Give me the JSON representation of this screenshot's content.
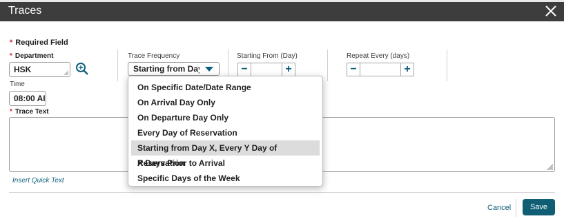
{
  "dialog": {
    "title": "Traces",
    "required_field": "Required Field"
  },
  "form": {
    "department": {
      "label": "Department",
      "value": "HSK"
    },
    "time": {
      "label": "Time",
      "value": "08:00 AI"
    },
    "trace_frequency": {
      "label": "Trace Frequency",
      "selected": "Starting from Day X"
    },
    "starting_from": {
      "label": "Starting From (Day)",
      "value": ""
    },
    "repeat_every": {
      "label": "Repeat Every (days)",
      "value": ""
    },
    "trace_text": {
      "label": "Trace Text",
      "value": ""
    },
    "insert_quick_text": "Insert Quick Text"
  },
  "dropdown": {
    "options": [
      "On Specific Date/Date Range",
      "On Arrival Day Only",
      "On Departure Day Only",
      "Every Day of Reservation",
      "Starting from Day X, Every Y Day of Reservation",
      "X Days Prior to Arrival",
      "Specific Days of the Week"
    ],
    "selected_index": 4
  },
  "footer": {
    "cancel": "Cancel",
    "save": "Save"
  },
  "colors": {
    "titlebar": "#3d3d3d",
    "accent": "#0f5e73",
    "required": "#c4262e"
  }
}
